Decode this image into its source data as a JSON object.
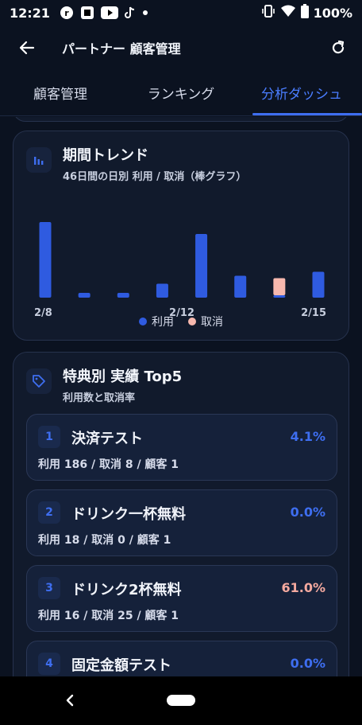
{
  "status_bar": {
    "time": "12:21",
    "battery": "100%",
    "icons": [
      "app-r-icon",
      "app-square-icon",
      "youtube-icon",
      "tiktok-icon",
      "dot-icon",
      "vibrate-icon",
      "wifi-icon",
      "battery-icon"
    ]
  },
  "app_bar": {
    "title": "パートナー 顧客管理"
  },
  "tabs": [
    {
      "label": "顧客管理"
    },
    {
      "label": "ランキング"
    },
    {
      "label": "分析ダッシュ"
    }
  ],
  "trend_card": {
    "title": "期間トレンド",
    "subtitle": "46日間の日別 利用 / 取消（棒グラフ）"
  },
  "chart_data": {
    "type": "bar",
    "title": "期間トレンド",
    "x_tick_labels": [
      "2/8",
      "2/12",
      "2/15"
    ],
    "series": [
      {
        "name": "利用",
        "color": "#2f5be0",
        "values": [
          19,
          1.2,
          1.2,
          3.5,
          16,
          5.5,
          0.6,
          6.5
        ]
      },
      {
        "name": "取消",
        "color": "#f7b8ae",
        "values": [
          0,
          0,
          0,
          0,
          0,
          0,
          4.3,
          0
        ]
      }
    ],
    "ylim": [
      0,
      20
    ],
    "grid": false,
    "legend": "bottom-center"
  },
  "legend": {
    "use_label": "利用",
    "cancel_label": "取消",
    "use_color": "#2f5be0",
    "cancel_color": "#f7b8ae"
  },
  "top5_card": {
    "title": "特典別 実績 Top5",
    "subtitle": "利用数と取消率",
    "items": [
      {
        "rank": "1",
        "name": "決済テスト",
        "rate": "4.1%",
        "rate_color": "#3e6ef0",
        "stats": "利用 186 / 取消 8 / 顧客 1"
      },
      {
        "rank": "2",
        "name": "ドリンク一杯無料",
        "rate": "0.0%",
        "rate_color": "#3e6ef0",
        "stats": "利用 18 / 取消 0 / 顧客 1"
      },
      {
        "rank": "3",
        "name": "ドリンク2杯無料",
        "rate": "61.0%",
        "rate_color": "#f4a99f",
        "stats": "利用 16 / 取消 25 / 顧客 1"
      },
      {
        "rank": "4",
        "name": "固定金額テスト",
        "rate": "0.0%",
        "rate_color": "#3e6ef0",
        "stats": ""
      }
    ]
  }
}
